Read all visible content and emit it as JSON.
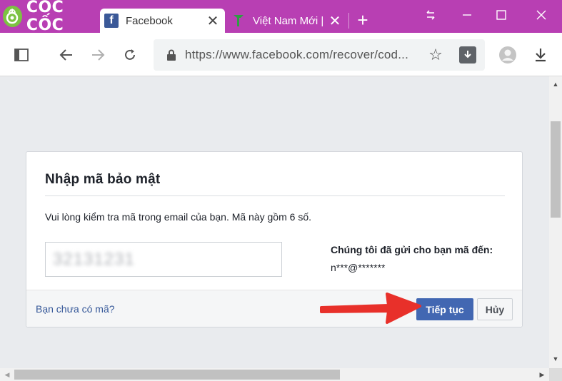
{
  "browser": {
    "brand_name": "CỐC CỐC",
    "accent_color": "#b83fb3",
    "tabs": [
      {
        "title": "Facebook",
        "favicon": "facebook-icon",
        "active": true
      },
      {
        "title": "Việt Nam Mới |",
        "favicon": "leaf-icon",
        "active": false
      }
    ],
    "window_controls": [
      "restore-tabs-icon",
      "minimize-icon",
      "maximize-icon",
      "close-icon"
    ],
    "url": "https://www.facebook.com/recover/cod..."
  },
  "dialog": {
    "title": "Nhập mã bảo mật",
    "description": "Vui lòng kiểm tra mã trong email của bạn. Mã này gồm 6 số.",
    "code_value": "32131231",
    "sent_label": "Chúng tôi đã gửi cho bạn mã đến:",
    "sent_email": "n***@*******",
    "no_code_link": "Bạn chưa có mã?",
    "continue_label": "Tiếp tục",
    "cancel_label": "Hủy",
    "primary_color": "#4267b2",
    "annotation_arrow_color": "#e8302a"
  }
}
